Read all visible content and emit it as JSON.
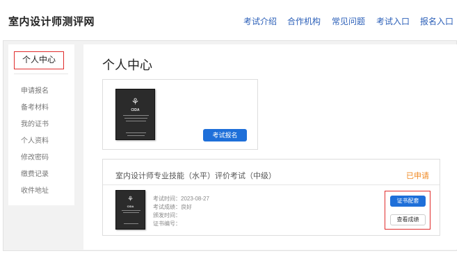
{
  "header": {
    "brand": "室内设计师测评网",
    "nav": [
      "考试介绍",
      "合作机构",
      "常见问题",
      "考试入口",
      "报名入口"
    ]
  },
  "sidebar": {
    "active": "个人中心",
    "items": [
      "申请报名",
      "备考材料",
      "我的证书",
      "个人资料",
      "修改密码",
      "缴费记录",
      "收件地址"
    ]
  },
  "main": {
    "title": "个人中心",
    "profile_card": {
      "button": "考试报名"
    },
    "exam": {
      "title": "室内设计师专业技能（水平）评价考试（中级）",
      "status": "已申请",
      "info": {
        "exam_time": "考试时间：2023-08-27",
        "score": "考试成绩：良好",
        "issue_time": "颁发时间：",
        "cert_no": "证书编号："
      },
      "primary_button": "证书配套",
      "secondary_button": "查看成绩"
    }
  },
  "book": {
    "brand": "CIDA"
  },
  "colors": {
    "accent": "#1e6fd9",
    "highlight": "#e02b2b",
    "status": "#f08a24",
    "nav": "#2b5fb8"
  }
}
